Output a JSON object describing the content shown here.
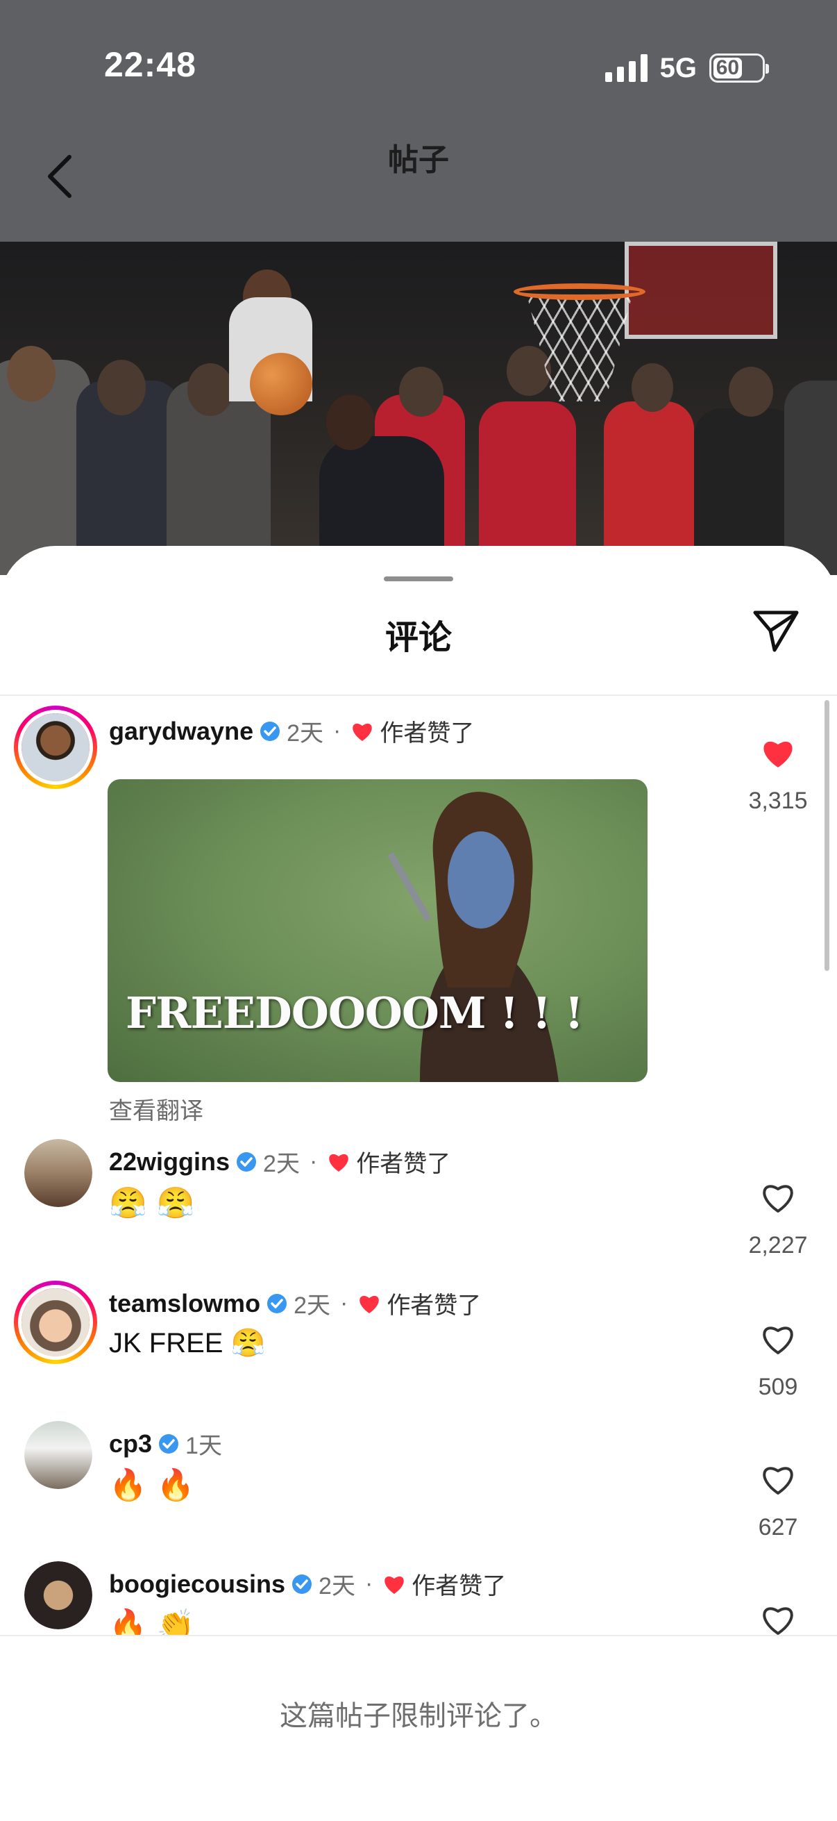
{
  "status_bar": {
    "time": "22:48",
    "network": "5G",
    "battery": "60"
  },
  "header": {
    "title": "帖子",
    "back_icon": "chevron-left-icon"
  },
  "sheet": {
    "title": "评论",
    "share_icon": "paper-plane-icon"
  },
  "comments": [
    {
      "username": "garydwayne",
      "verified": true,
      "time": "2天",
      "author_liked": "作者赞了",
      "text": "",
      "gif_caption": "FREEDOOOOM ! ! !",
      "translate": "查看翻译",
      "likes": "3,315",
      "liked": true
    },
    {
      "username": "22wiggins",
      "verified": true,
      "time": "2天",
      "author_liked": "作者赞了",
      "text": "😤 😤",
      "likes": "2,227",
      "liked": false
    },
    {
      "username": "teamslowmo",
      "verified": true,
      "time": "2天",
      "author_liked": "作者赞了",
      "text": "JK FREE 😤",
      "likes": "509",
      "liked": false
    },
    {
      "username": "cp3",
      "verified": true,
      "time": "1天",
      "author_liked": "",
      "text": "🔥 🔥",
      "likes": "627",
      "liked": false
    },
    {
      "username": "boogiecousins",
      "verified": true,
      "time": "2天",
      "author_liked": "作者赞了",
      "text": "🔥 👏",
      "likes": "",
      "liked": false
    }
  ],
  "footer": {
    "notice": "这篇帖子限制评论了。"
  },
  "colors": {
    "header_bg": "#5f6063",
    "like_red": "#ff3040",
    "verified_blue": "#3897f0",
    "muted_text": "#6e6e6e"
  },
  "dot_separator": "·"
}
